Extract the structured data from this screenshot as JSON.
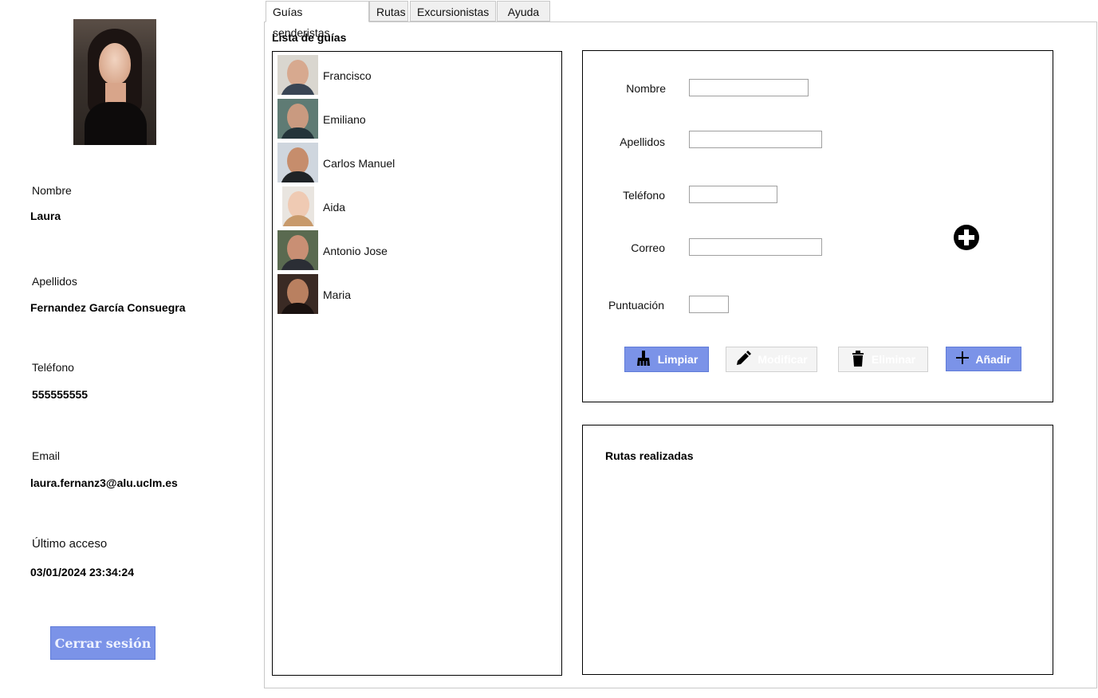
{
  "profile": {
    "fields": [
      {
        "label": "Nombre",
        "value": "Laura"
      },
      {
        "label": "Apellidos",
        "value": "Fernandez García Consuegra"
      },
      {
        "label": "Teléfono",
        "value": "555555555"
      },
      {
        "label": "Email",
        "value": "laura.fernanz3@alu.uclm.es"
      },
      {
        "label": "Último acceso",
        "value": "03/01/2024 23:34:24"
      }
    ],
    "logout_label": "Cerrar sesión"
  },
  "tabs": [
    {
      "label": "Guías senderistas",
      "active": true
    },
    {
      "label": "Rutas",
      "active": false
    },
    {
      "label": "Excursionistas",
      "active": false
    },
    {
      "label": "Ayuda",
      "active": false
    }
  ],
  "guides": {
    "title": "Lista de guías",
    "items": [
      {
        "name": "Francisco"
      },
      {
        "name": "Emiliano"
      },
      {
        "name": "Carlos Manuel"
      },
      {
        "name": "Aida"
      },
      {
        "name": "Antonio Jose"
      },
      {
        "name": "Maria"
      }
    ]
  },
  "form": {
    "nombre_label": "Nombre",
    "nombre_value": "",
    "apellidos_label": "Apellidos",
    "apellidos_value": "",
    "telefono_label": "Teléfono",
    "telefono_value": "",
    "correo_label": "Correo",
    "correo_value": "",
    "puntuacion_label": "Puntuación",
    "puntuacion_value": "",
    "buttons": {
      "limpiar": "Limpiar",
      "modificar": "Modificar",
      "eliminar": "Eliminar",
      "anadir": "Añadir"
    }
  },
  "routes": {
    "title": "Rutas realizadas"
  },
  "colors": {
    "accent": "#7b93e8",
    "disabled": "#f4f4f4"
  }
}
